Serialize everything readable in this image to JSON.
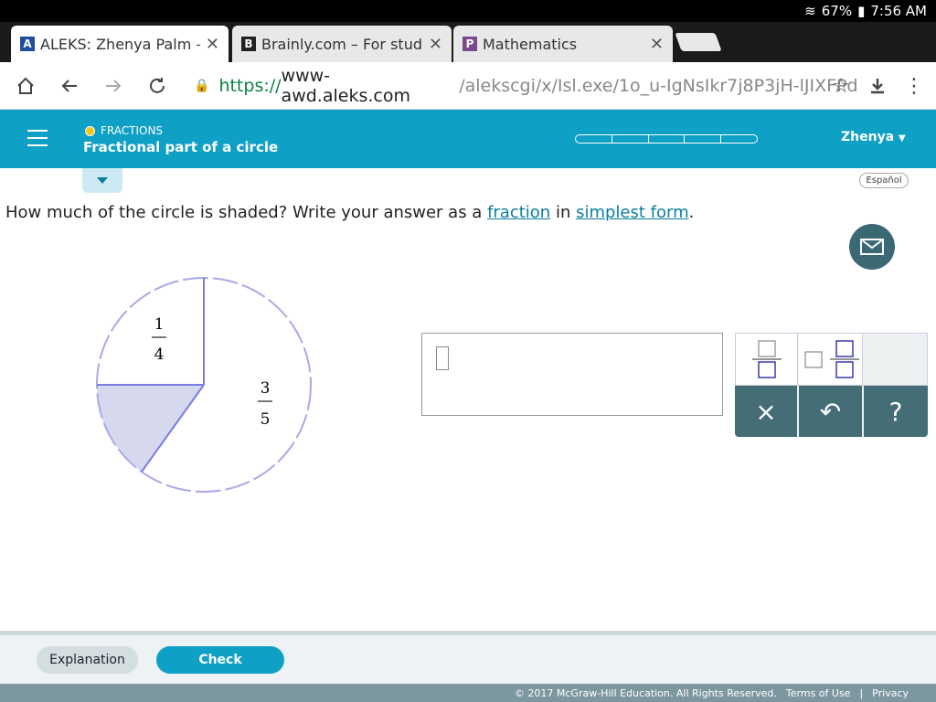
{
  "status_bar": {
    "battery": "67%",
    "time": "7:56 AM"
  },
  "tabs": [
    {
      "favicon": "A",
      "title": "ALEKS: Zhenya Palm – L"
    },
    {
      "favicon": "B",
      "title": "Brainly.com – For studen"
    },
    {
      "favicon": "P",
      "title": "Mathematics"
    }
  ],
  "address": {
    "scheme": "https://",
    "host": "www-awd.aleks.com",
    "path": "/alekscgi/x/Isl.exe/1o_u-IgNsIkr7j8P3jH-lJIXFPd"
  },
  "header": {
    "topic": "FRACTIONS",
    "subtitle": "Fractional part of a circle",
    "user": "Zhenya",
    "progress_segments": 5
  },
  "espanol": "Español",
  "question": {
    "before": "How much of the circle is shaded? Write your answer as a ",
    "link1": "fraction",
    "middle": " in ",
    "link2": "simplest form",
    "after": "."
  },
  "figure": {
    "label_a_num": "1",
    "label_a_den": "4",
    "label_b_num": "3",
    "label_b_den": "5",
    "shaded_color": "#d6d8ee",
    "line_color": "#7b7be0"
  },
  "keypad": {
    "clear": "×",
    "undo": "↶",
    "help": "?"
  },
  "buttons": {
    "explanation": "Explanation",
    "check": "Check"
  },
  "footer": {
    "copyright": "© 2017 McGraw-Hill Education. All Rights Reserved.",
    "terms": "Terms of Use",
    "sep": "|",
    "privacy": "Privacy"
  }
}
